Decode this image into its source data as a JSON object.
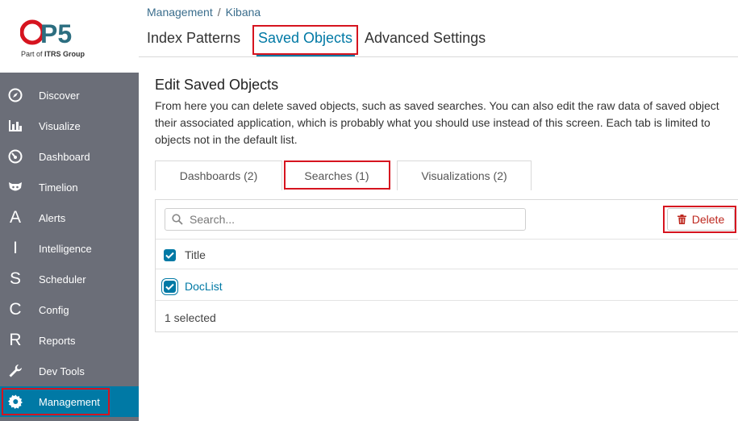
{
  "logo": {
    "brand": "OP5",
    "tagline_prefix": "Part of ",
    "tagline_brand": "ITRS Group"
  },
  "sidebar": {
    "items": [
      {
        "label": "Discover",
        "icon": "compass-icon"
      },
      {
        "label": "Visualize",
        "icon": "bar-chart-icon"
      },
      {
        "label": "Dashboard",
        "icon": "gauge-icon"
      },
      {
        "label": "Timelion",
        "icon": "timelion-icon"
      },
      {
        "label": "Alerts",
        "icon": "letter-a-icon",
        "letter": "A"
      },
      {
        "label": "Intelligence",
        "icon": "letter-i-icon",
        "letter": "I"
      },
      {
        "label": "Scheduler",
        "icon": "letter-s-icon",
        "letter": "S"
      },
      {
        "label": "Config",
        "icon": "letter-c-icon",
        "letter": "C"
      },
      {
        "label": "Reports",
        "icon": "letter-r-icon",
        "letter": "R"
      },
      {
        "label": "Dev Tools",
        "icon": "wrench-icon"
      },
      {
        "label": "Management",
        "icon": "gear-icon",
        "active": true
      }
    ],
    "active_color": "#0079a5"
  },
  "breadcrumb": {
    "parent": "Management",
    "separator": "/",
    "current": "Kibana"
  },
  "top_tabs": [
    {
      "label": "Index Patterns"
    },
    {
      "label": "Saved Objects",
      "active": true
    },
    {
      "label": "Advanced Settings"
    }
  ],
  "main": {
    "title": "Edit Saved Objects",
    "description": "From here you can delete saved objects, such as saved searches. You can also edit the raw data of saved object\ntheir associated application, which is probably what you should use instead of this screen. Each tab is limited to\nobjects not in the default list."
  },
  "object_tabs": [
    {
      "label": "Dashboards (2)"
    },
    {
      "label": "Searches (1)",
      "active": true
    },
    {
      "label": "Visualizations (2)"
    }
  ],
  "table": {
    "search_placeholder": "Search...",
    "delete_label": "Delete",
    "column_title": "Title",
    "rows": [
      {
        "title": "DocList",
        "checked": true
      }
    ],
    "selected_text": "1 selected"
  },
  "colors": {
    "accent": "#0079a5",
    "highlight": "#d6141f",
    "sidebar_bg": "#6b6e78",
    "danger": "#bd271e"
  }
}
